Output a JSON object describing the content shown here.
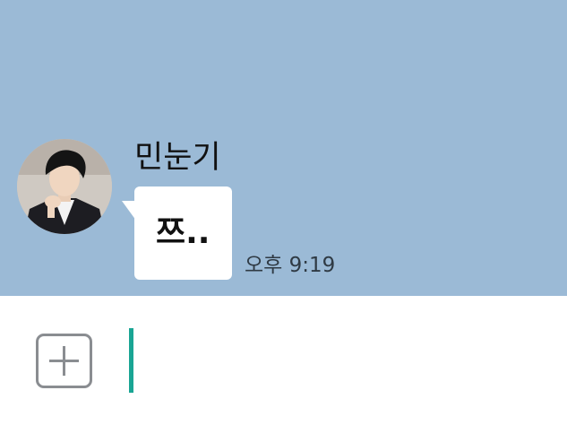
{
  "conversation": {
    "sender_name": "민눈기",
    "avatar_icon": "user-photo-icon",
    "message": {
      "text": "쯔..",
      "time": "오후 9:19"
    }
  },
  "input_bar": {
    "attach_icon": "plus-square-icon",
    "value": ""
  },
  "colors": {
    "chat_background": "#9bbad6",
    "bubble": "#ffffff",
    "caret": "#1aa594",
    "icon_border": "#8a8d91"
  }
}
